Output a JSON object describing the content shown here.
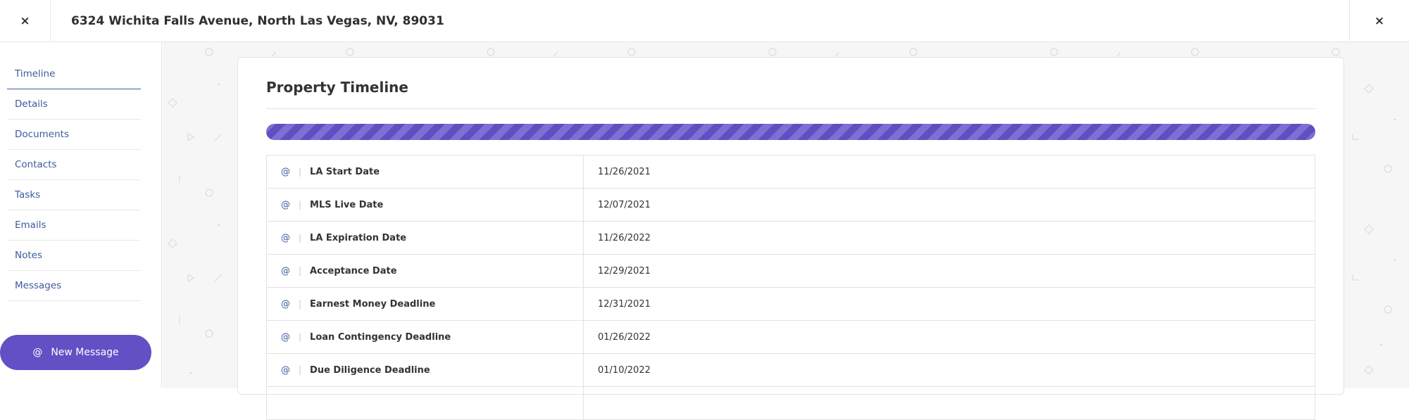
{
  "header": {
    "title": "6324 Wichita Falls Avenue, North Las Vegas, NV, 89031",
    "close_glyph": "×"
  },
  "sidebar": {
    "items": [
      {
        "label": "Timeline",
        "active": true
      },
      {
        "label": "Details"
      },
      {
        "label": "Documents"
      },
      {
        "label": "Contacts"
      },
      {
        "label": "Tasks"
      },
      {
        "label": "Emails"
      },
      {
        "label": "Notes"
      },
      {
        "label": "Messages"
      }
    ],
    "new_message": {
      "icon": "@",
      "label": "New Message"
    }
  },
  "main": {
    "card_title": "Property Timeline",
    "progress": {
      "percent": 100
    },
    "row_icon": "@",
    "row_separator": "|",
    "rows": [
      {
        "label": "LA Start Date",
        "value": "11/26/2021"
      },
      {
        "label": "MLS Live Date",
        "value": "12/07/2021"
      },
      {
        "label": "LA Expiration Date",
        "value": "11/26/2022"
      },
      {
        "label": "Acceptance Date",
        "value": "12/29/2021"
      },
      {
        "label": "Earnest Money Deadline",
        "value": "12/31/2021"
      },
      {
        "label": "Loan Contingency Deadline",
        "value": "01/26/2022"
      },
      {
        "label": "Due Diligence Deadline",
        "value": "01/10/2022"
      },
      {
        "label": "",
        "value": ""
      }
    ]
  },
  "colors": {
    "accent": "#6250c4",
    "link": "#3d5a9e",
    "progress_stripe": "#7d6fd3",
    "background": "#f6f6f7"
  }
}
